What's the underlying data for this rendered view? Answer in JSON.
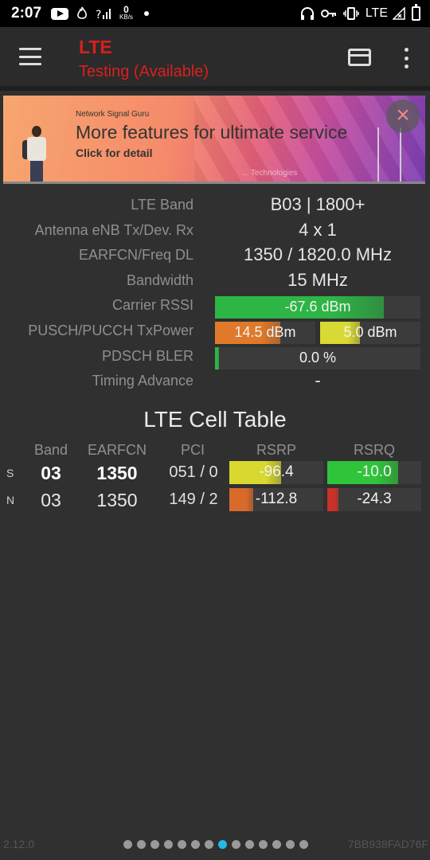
{
  "status_bar": {
    "time": "2:07",
    "network_speed": "0",
    "network_speed_unit": "KB/s",
    "network_type": "LTE"
  },
  "app_bar": {
    "title": "LTE",
    "subtitle": "Testing (Available)"
  },
  "ad": {
    "brand": "Network Signal Guru",
    "headline": "More features for ultimate service",
    "cta": "Click for detail",
    "footer": "... Technologies",
    "close_icon": "×"
  },
  "info": {
    "band": {
      "label": "LTE Band",
      "value": "B03 | 1800+"
    },
    "antenna": {
      "label": "Antenna eNB Tx/Dev. Rx",
      "value": "4 x 1"
    },
    "earfcn": {
      "label": "EARFCN/Freq DL",
      "value": "1350 / 1820.0 MHz"
    },
    "bandwidth": {
      "label": "Bandwidth",
      "value": "15 MHz"
    },
    "rssi": {
      "label": "Carrier RSSI",
      "value": "-67.6 dBm",
      "fill": 0.82,
      "color": "#2db545"
    },
    "txpower": {
      "label": "PUSCH/PUCCH TxPower",
      "pusch": {
        "value": "14.5 dBm",
        "fill": 0.65,
        "color": "#e07a2a"
      },
      "pucch": {
        "value": "5.0 dBm",
        "fill": 0.4,
        "color": "#d9d935"
      }
    },
    "bler": {
      "label": "PDSCH BLER",
      "value": "0.0 %",
      "fill": 0.02,
      "color": "#2db545"
    },
    "timing_advance": {
      "label": "Timing Advance",
      "value": "-"
    }
  },
  "cell_table": {
    "title": "LTE Cell Table",
    "headers": {
      "band": "Band",
      "earfcn": "EARFCN",
      "pci": "PCI",
      "rsrp": "RSRP",
      "rsrq": "RSRQ"
    },
    "rows": [
      {
        "type": "S",
        "band": "03",
        "earfcn": "1350",
        "pci": "051 / 0",
        "rsrp": {
          "value": "-96.4",
          "fill": 0.55,
          "color": "#d8d830"
        },
        "rsrq": {
          "value": "-10.0",
          "fill": 0.75,
          "color": "#2fc43a"
        }
      },
      {
        "type": "N",
        "band": "03",
        "earfcn": "1350",
        "pci": "149 / 2",
        "rsrp": {
          "value": "-112.8",
          "fill": 0.25,
          "color": "#d86a2a"
        },
        "rsrq": {
          "value": "-24.3",
          "fill": 0.12,
          "color": "#c83228"
        }
      }
    ]
  },
  "footer": {
    "version": "2.12.0",
    "device_id": "7BB938FAD76F",
    "pages": 14,
    "active_page": 8
  }
}
